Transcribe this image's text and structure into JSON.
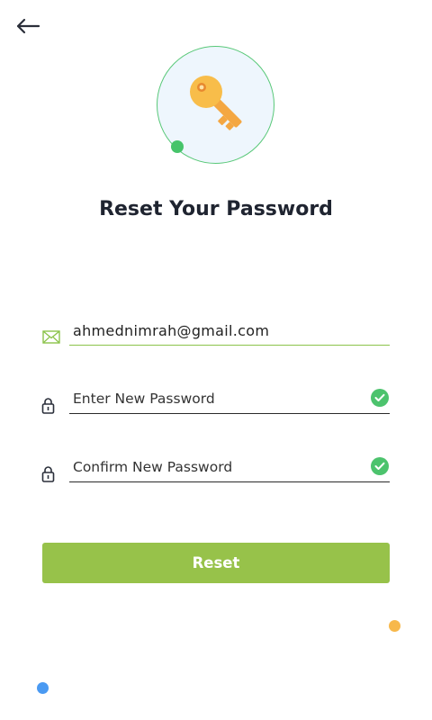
{
  "header": {
    "back_icon": "arrow-left-icon"
  },
  "hero": {
    "icon": "key-icon",
    "accent": "#46c46a",
    "key_color": "#f6b64a"
  },
  "page": {
    "title": "Reset Your Password"
  },
  "form": {
    "email": {
      "icon": "mail-icon",
      "value": "ahmednimrah@gmail.com",
      "placeholder": ""
    },
    "new_password": {
      "icon": "lock-icon",
      "value": "",
      "placeholder": "Enter New Password",
      "valid": true
    },
    "confirm_password": {
      "icon": "lock-icon",
      "value": "",
      "placeholder": "Confirm New Password",
      "valid": true
    },
    "submit_label": "Reset"
  },
  "colors": {
    "primary": "#97c24a",
    "valid": "#4cc36d",
    "dot_orange": "#f7b84b",
    "dot_blue": "#4a9af2"
  }
}
